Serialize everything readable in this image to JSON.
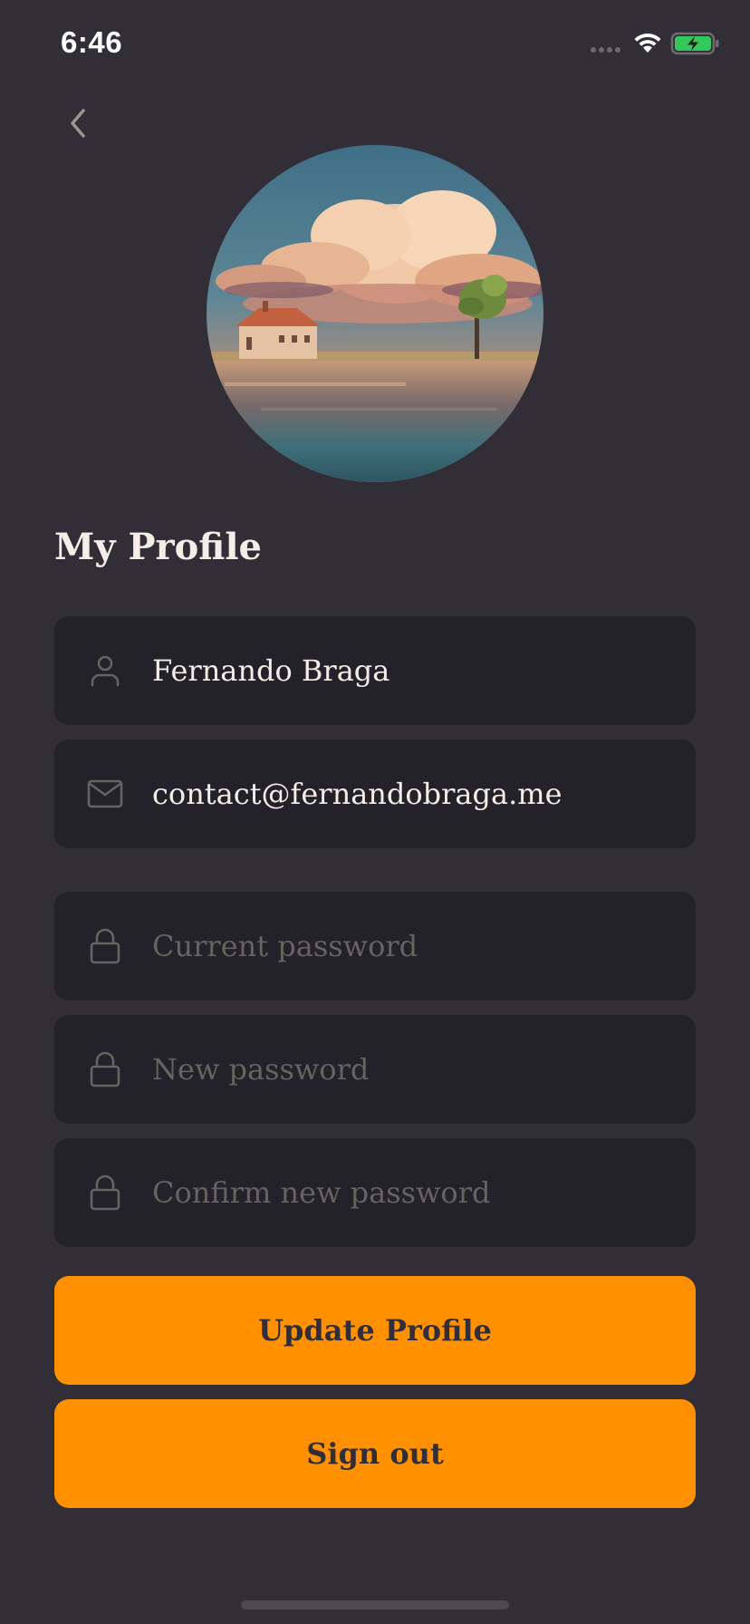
{
  "status_bar": {
    "time": "6:46"
  },
  "header": {
    "back_icon": "chevron-left-icon"
  },
  "profile": {
    "title": "My Profile",
    "avatar_alt": "Profile avatar"
  },
  "form": {
    "name": {
      "icon": "user-icon",
      "value": "Fernando Braga",
      "placeholder": ""
    },
    "email": {
      "icon": "mail-icon",
      "value": "contact@fernandobraga.me",
      "placeholder": ""
    },
    "current_password": {
      "icon": "lock-icon",
      "value": "",
      "placeholder": "Current password"
    },
    "new_password": {
      "icon": "lock-icon",
      "value": "",
      "placeholder": "New password"
    },
    "confirm_password": {
      "icon": "lock-icon",
      "value": "",
      "placeholder": "Confirm new password"
    }
  },
  "actions": {
    "update_label": "Update Profile",
    "signout_label": "Sign out"
  },
  "colors": {
    "background": "#312e38",
    "input_background": "#232129",
    "accent": "#ff9000",
    "text": "#f4ede8",
    "placeholder": "#666360"
  }
}
